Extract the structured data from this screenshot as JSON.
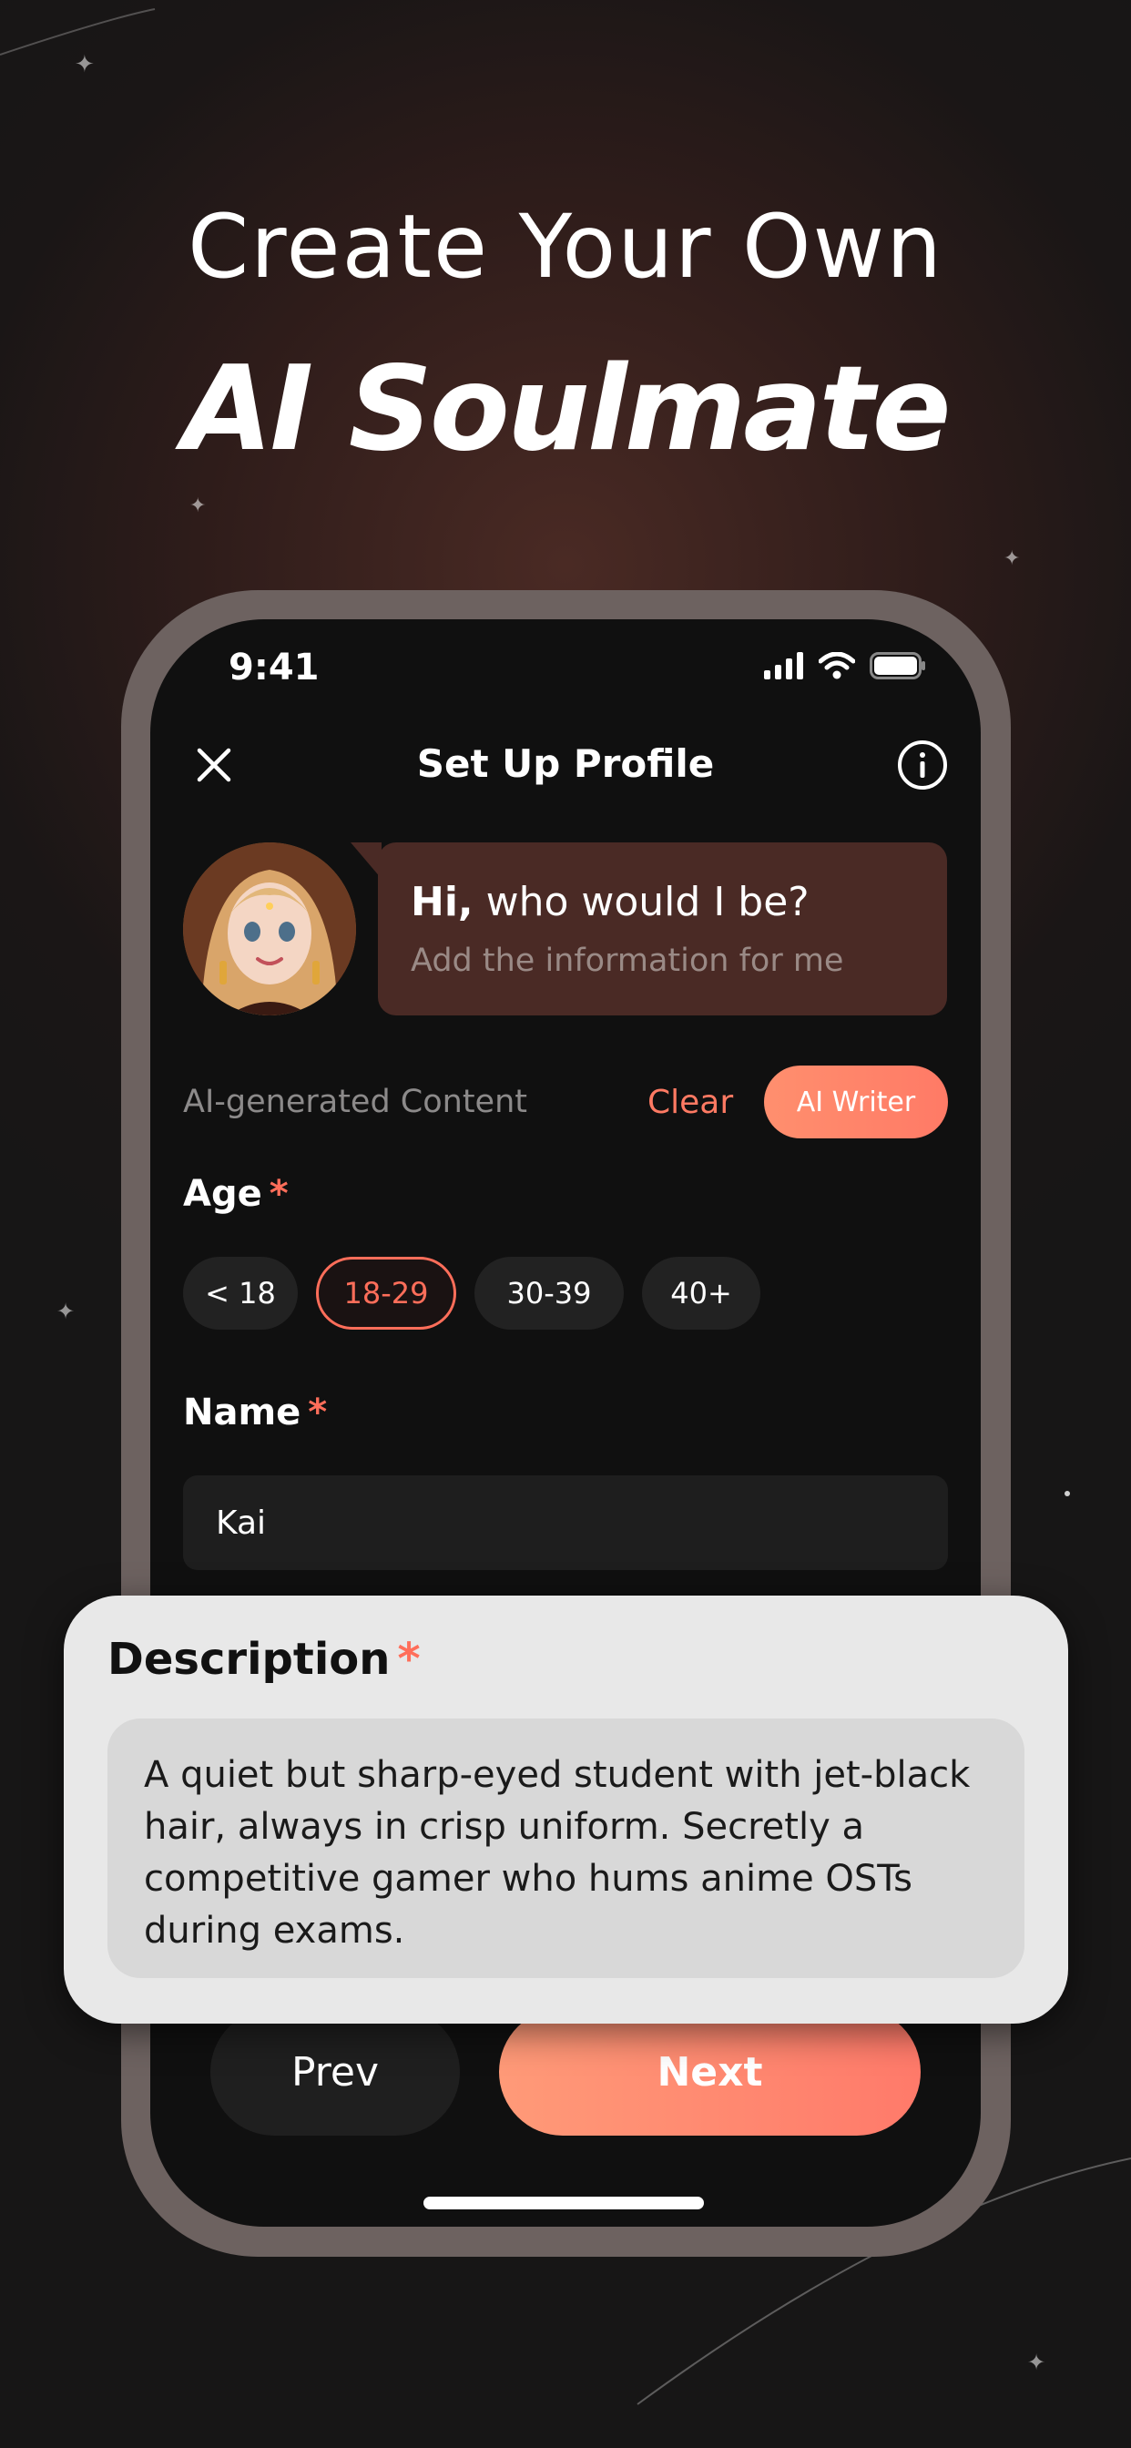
{
  "headline": {
    "line1": "Create Your Own",
    "line2": "AI Soulmate"
  },
  "status_bar": {
    "time": "9:41"
  },
  "nav": {
    "title": "Set Up Profile"
  },
  "intro": {
    "greeting_bold": "Hi,",
    "greeting_rest": " who would I be?",
    "subtitle": "Add the information for me"
  },
  "ai_row": {
    "label": "AI-generated Content",
    "clear": "Clear",
    "writer": "AI Writer"
  },
  "age": {
    "label": "Age",
    "required_mark": "*",
    "options": [
      "< 18",
      "18-29",
      "30-39",
      "40+"
    ],
    "selected": "18-29"
  },
  "name": {
    "label": "Name",
    "required_mark": "*",
    "value": "Kai"
  },
  "description": {
    "label": "Description",
    "required_mark": "*",
    "value": "A quiet but sharp-eyed student with jet-black hair, always in crisp uniform. Secretly a competitive gamer who hums anime OSTs during exams."
  },
  "footer": {
    "prev": "Prev",
    "next": "Next"
  },
  "colors": {
    "accent": "#ff7a63",
    "background": "#171616",
    "card": "#e8e8e8"
  }
}
